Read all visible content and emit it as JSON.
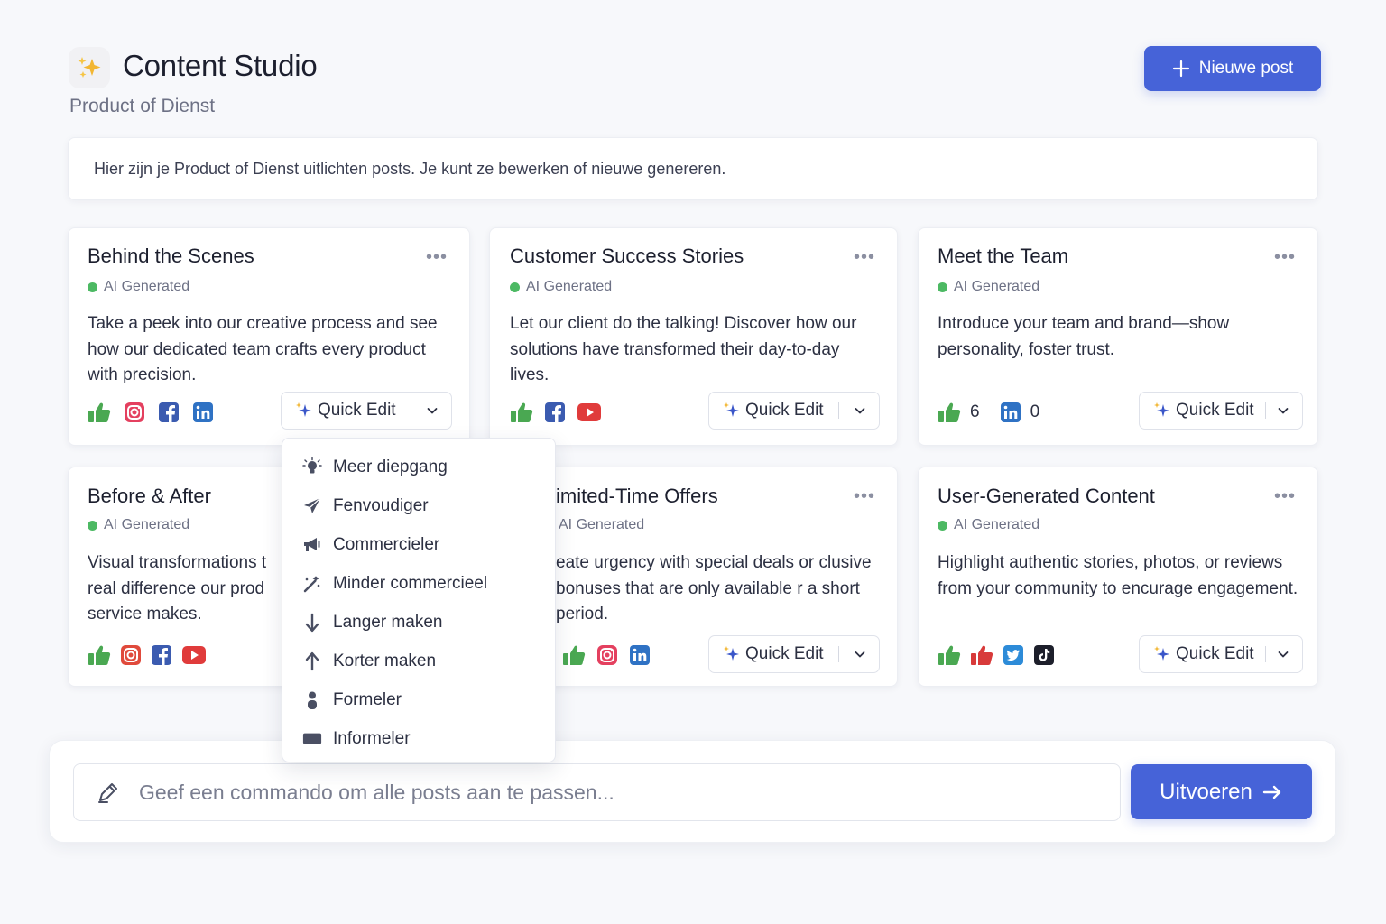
{
  "header": {
    "title": "Content Studio",
    "subtitle": "Product of Dienst",
    "new_post_label": "Nieuwe post"
  },
  "intro": {
    "text": "Hier zijn je Product of Dienst uitlichten posts. Je kunt ze bewerken of nieuwe genereren."
  },
  "cards": [
    {
      "title": "Behind the Scenes",
      "badge": "AI Generated",
      "text": "Take a peek into our creative process and see how our dedicated team crafts every product with precision.",
      "icons": [
        "thumbs-up",
        "instagram",
        "facebook",
        "linkedin"
      ],
      "quick_edit_label": "Quick Edit"
    },
    {
      "title": "Customer Success Stories",
      "badge": "AI Generated",
      "text": "Let our client do the talking! Discover how our solutions have transformed their day-to-day lives.",
      "icons": [
        "thumbs-up",
        "facebook",
        "youtube"
      ],
      "quick_edit_label": "Quick Edit"
    },
    {
      "title": "Meet the Team",
      "badge": "AI Generated",
      "text": "Introduce your team and brand—show personality, foster trust.",
      "icons": [
        "thumbs-up",
        "linkedin"
      ],
      "likes_count": "6",
      "linkedin_count": "0",
      "quick_edit_label": "Quick Edit"
    },
    {
      "title": "Before & After",
      "badge": "AI Generated",
      "text": "Visual transformations t real difference our prod service makes.",
      "icons": [
        "thumbs-up",
        "instagram",
        "facebook",
        "youtube"
      ]
    },
    {
      "title": "imited-Time Offers",
      "badge": "AI Generated",
      "text": "eate urgency with special deals or clusive bonuses that are only available r a short period.",
      "icons": [
        "thumbs-up",
        "instagram",
        "linkedin"
      ],
      "quick_edit_label": "Quick Edit"
    },
    {
      "title": "User-Generated Content",
      "badge": "AI Generated",
      "text": "Highlight authentic stories, photos, or reviews from your community to encurage engagement.",
      "icons": [
        "thumbs-up",
        "thumbs-down",
        "twitter",
        "tiktok"
      ],
      "quick_edit_label": "Quick Edit"
    }
  ],
  "dropdown": {
    "items": [
      {
        "label": "Meer diepgang",
        "icon": "lightbulb-icon"
      },
      {
        "label": "Fenvoudiger",
        "icon": "paper-plane-icon"
      },
      {
        "label": "Commercieler",
        "icon": "megaphone-icon"
      },
      {
        "label": "Minder commercieel",
        "icon": "magic-wand-icon"
      },
      {
        "label": "Langer maken",
        "icon": "arrow-down-icon"
      },
      {
        "label": "Korter maken",
        "icon": "arrow-up-icon"
      },
      {
        "label": "Formeler",
        "icon": "person-icon"
      },
      {
        "label": "Informeler",
        "icon": "chat-icon"
      }
    ]
  },
  "command": {
    "placeholder": "Geef een commando om alle posts aan te passen...",
    "run_label": "Uitvoeren"
  },
  "colors": {
    "primary": "#4663d8",
    "badge_green": "#4cb963",
    "instagram": "#e4405f",
    "facebook": "#3b5bb0",
    "linkedin": "#2f72c4",
    "youtube": "#e03b3b"
  }
}
